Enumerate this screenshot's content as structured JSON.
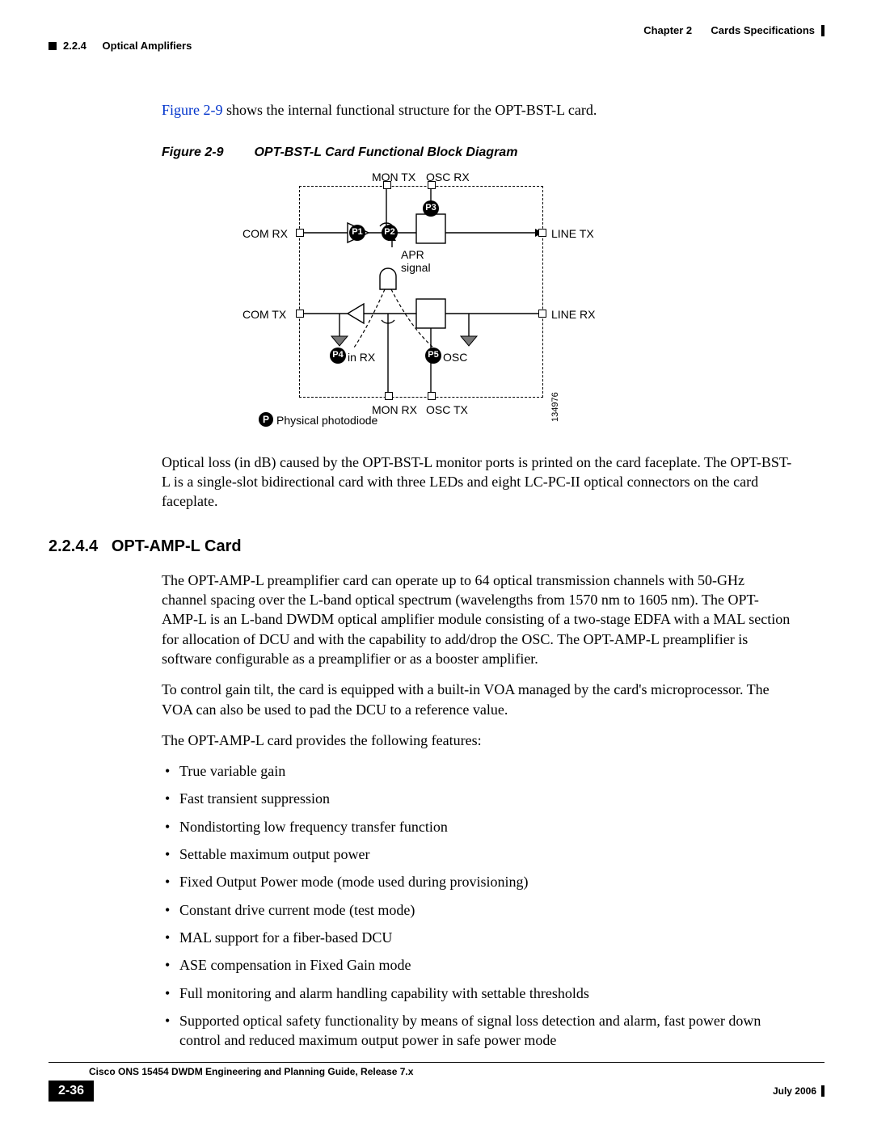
{
  "header": {
    "chapter": "Chapter 2",
    "chapter_title": "Cards Specifications",
    "section_num": "2.2.4",
    "section_title": "Optical Amplifiers"
  },
  "intro_sentence_prefix": "Figure 2-9",
  "intro_sentence_rest": " shows the internal functional structure for the OPT-BST-L card.",
  "figure": {
    "number": "Figure 2-9",
    "title": "OPT-BST-L Card Functional Block Diagram",
    "labels": {
      "mon_tx": "MON TX",
      "osc_rx": "OSC RX",
      "com_rx": "COM RX",
      "line_tx": "LINE TX",
      "apr": "APR",
      "signal": "signal",
      "com_tx": "COM TX",
      "line_rx": "LINE RX",
      "in_rx": "in RX",
      "osc": "OSC",
      "mon_rx": "MON RX",
      "osc_tx": "OSC TX",
      "p1": "P1",
      "p2": "P2",
      "p3": "P3",
      "p4": "P4",
      "p5": "P5",
      "p_marker": "P",
      "legend": "Physical photodiode",
      "sidenum": "134976"
    }
  },
  "post_figure_paragraph": "Optical loss (in dB) caused by the OPT-BST-L monitor ports is printed on the card faceplate. The OPT-BST-L is a single-slot bidirectional card with three LEDs and eight LC-PC-II optical connectors on the card faceplate.",
  "section": {
    "number": "2.2.4.4",
    "title": "OPT-AMP-L Card"
  },
  "paragraphs": {
    "p1": "The OPT-AMP-L preamplifier card can operate up to 64 optical transmission channels with 50-GHz channel spacing over the L-band optical spectrum (wavelengths from 1570 nm to 1605 nm). The OPT-AMP-L is an L-band DWDM optical amplifier module consisting of a two-stage EDFA with a MAL section for allocation of DCU and with the capability to add/drop the OSC. The OPT-AMP-L preamplifier is software configurable as a preamplifier or as a booster amplifier.",
    "p2": "To control gain tilt, the card is equipped with a built-in VOA managed by the card's microprocessor. The VOA can also be used to pad the DCU to a reference value.",
    "p3": "The OPT-AMP-L card provides the following features:"
  },
  "features": [
    "True variable gain",
    "Fast transient suppression",
    "Nondistorting low frequency transfer function",
    "Settable maximum output power",
    "Fixed Output Power mode (mode used during provisioning)",
    "Constant drive current mode (test mode)",
    "MAL support for a fiber-based DCU",
    "ASE compensation in Fixed Gain mode",
    "Full monitoring and alarm handling capability with settable thresholds",
    "Supported optical safety functionality by means of signal loss detection and alarm, fast power down control and reduced maximum output power in safe power mode"
  ],
  "footer": {
    "doc_title": "Cisco ONS 15454 DWDM Engineering and Planning Guide, Release 7.x",
    "page_number": "2-36",
    "date": "July 2006"
  }
}
